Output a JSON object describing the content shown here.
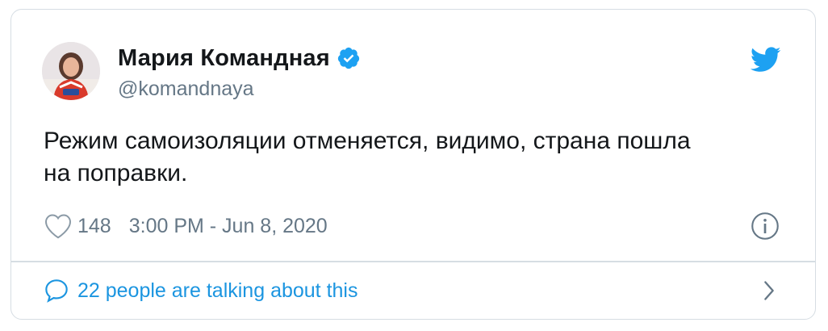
{
  "tweet": {
    "author_name": "Мария Командная",
    "author_handle": "@komandnaya",
    "verified": true,
    "text_line_1": "Режим самоизоляции отменяется, видимо, страна пошла",
    "text_line_2": "на поправки.",
    "likes": "148",
    "timestamp": "3:00 PM - Jun 8, 2020",
    "talking_text": "22 people are talking about this"
  },
  "icons": {
    "verified": "verified-badge-icon",
    "brand": "twitter-bird-icon",
    "like": "heart-icon",
    "info": "info-icon",
    "reply": "speech-bubble-icon",
    "more": "chevron-right-icon"
  },
  "colors": {
    "twitter_blue": "#1da1f2",
    "link_blue": "#1b95e0",
    "text_primary": "#14171a",
    "text_secondary": "#657786",
    "border": "#d6dde3"
  }
}
